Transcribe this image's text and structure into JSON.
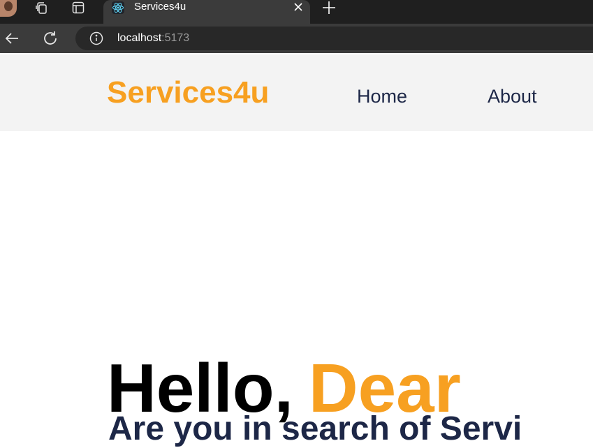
{
  "browser": {
    "tab_title": "Services4u",
    "url_host": "localhost",
    "url_port": ":5173",
    "icons": {
      "profile": "profile-avatar",
      "collections": "collections-icon",
      "tab_actions": "tab-actions-icon",
      "favicon": "react-icon",
      "close": "close-icon",
      "new_tab": "plus-icon",
      "back": "back-arrow-icon",
      "reload": "reload-icon",
      "site_info": "info-icon"
    }
  },
  "header": {
    "brand": "Services4u",
    "nav": [
      {
        "label": "Home"
      },
      {
        "label": "About"
      }
    ]
  },
  "hero": {
    "greeting": "Hello,",
    "highlight": "Dear",
    "subtitle": "Are you in search of Servi"
  },
  "colors": {
    "accent": "#f7a021",
    "navy": "#1d2747",
    "header_bg": "#f3f3f3",
    "chrome_dark": "#1f1f1f",
    "chrome_mid": "#3b3b3b"
  }
}
